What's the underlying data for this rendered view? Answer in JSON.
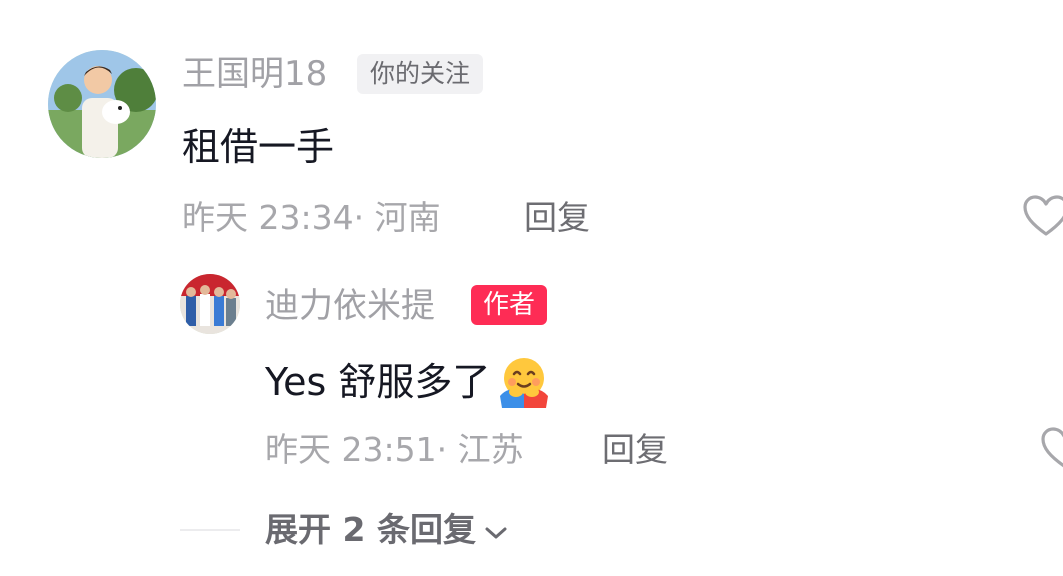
{
  "comment": {
    "username": "王国明18",
    "follow_tag": "你的关注",
    "text": "租借一手",
    "time": "昨天 23:34",
    "location_sep": "·",
    "location": "河南",
    "reply_label": "回复",
    "avatar_icon": "avatar-man-holding-dog",
    "like_icon": "heart-outline-icon"
  },
  "reply": {
    "username": "迪力依米提",
    "author_tag": "作者",
    "text": "Yes 舒服多了",
    "emoji": "hugging-face-emoji",
    "time": "昨天 23:51",
    "location_sep": "·",
    "location": "江苏",
    "reply_label": "回复",
    "avatar_icon": "avatar-group-photo",
    "like_icon": "heart-outline-icon"
  },
  "expand": {
    "label": "展开 2 条回复",
    "icon": "chevron-down-icon"
  },
  "colors": {
    "author_tag": "#fe2c55",
    "username": "#a1a1a6",
    "text": "#161823"
  }
}
